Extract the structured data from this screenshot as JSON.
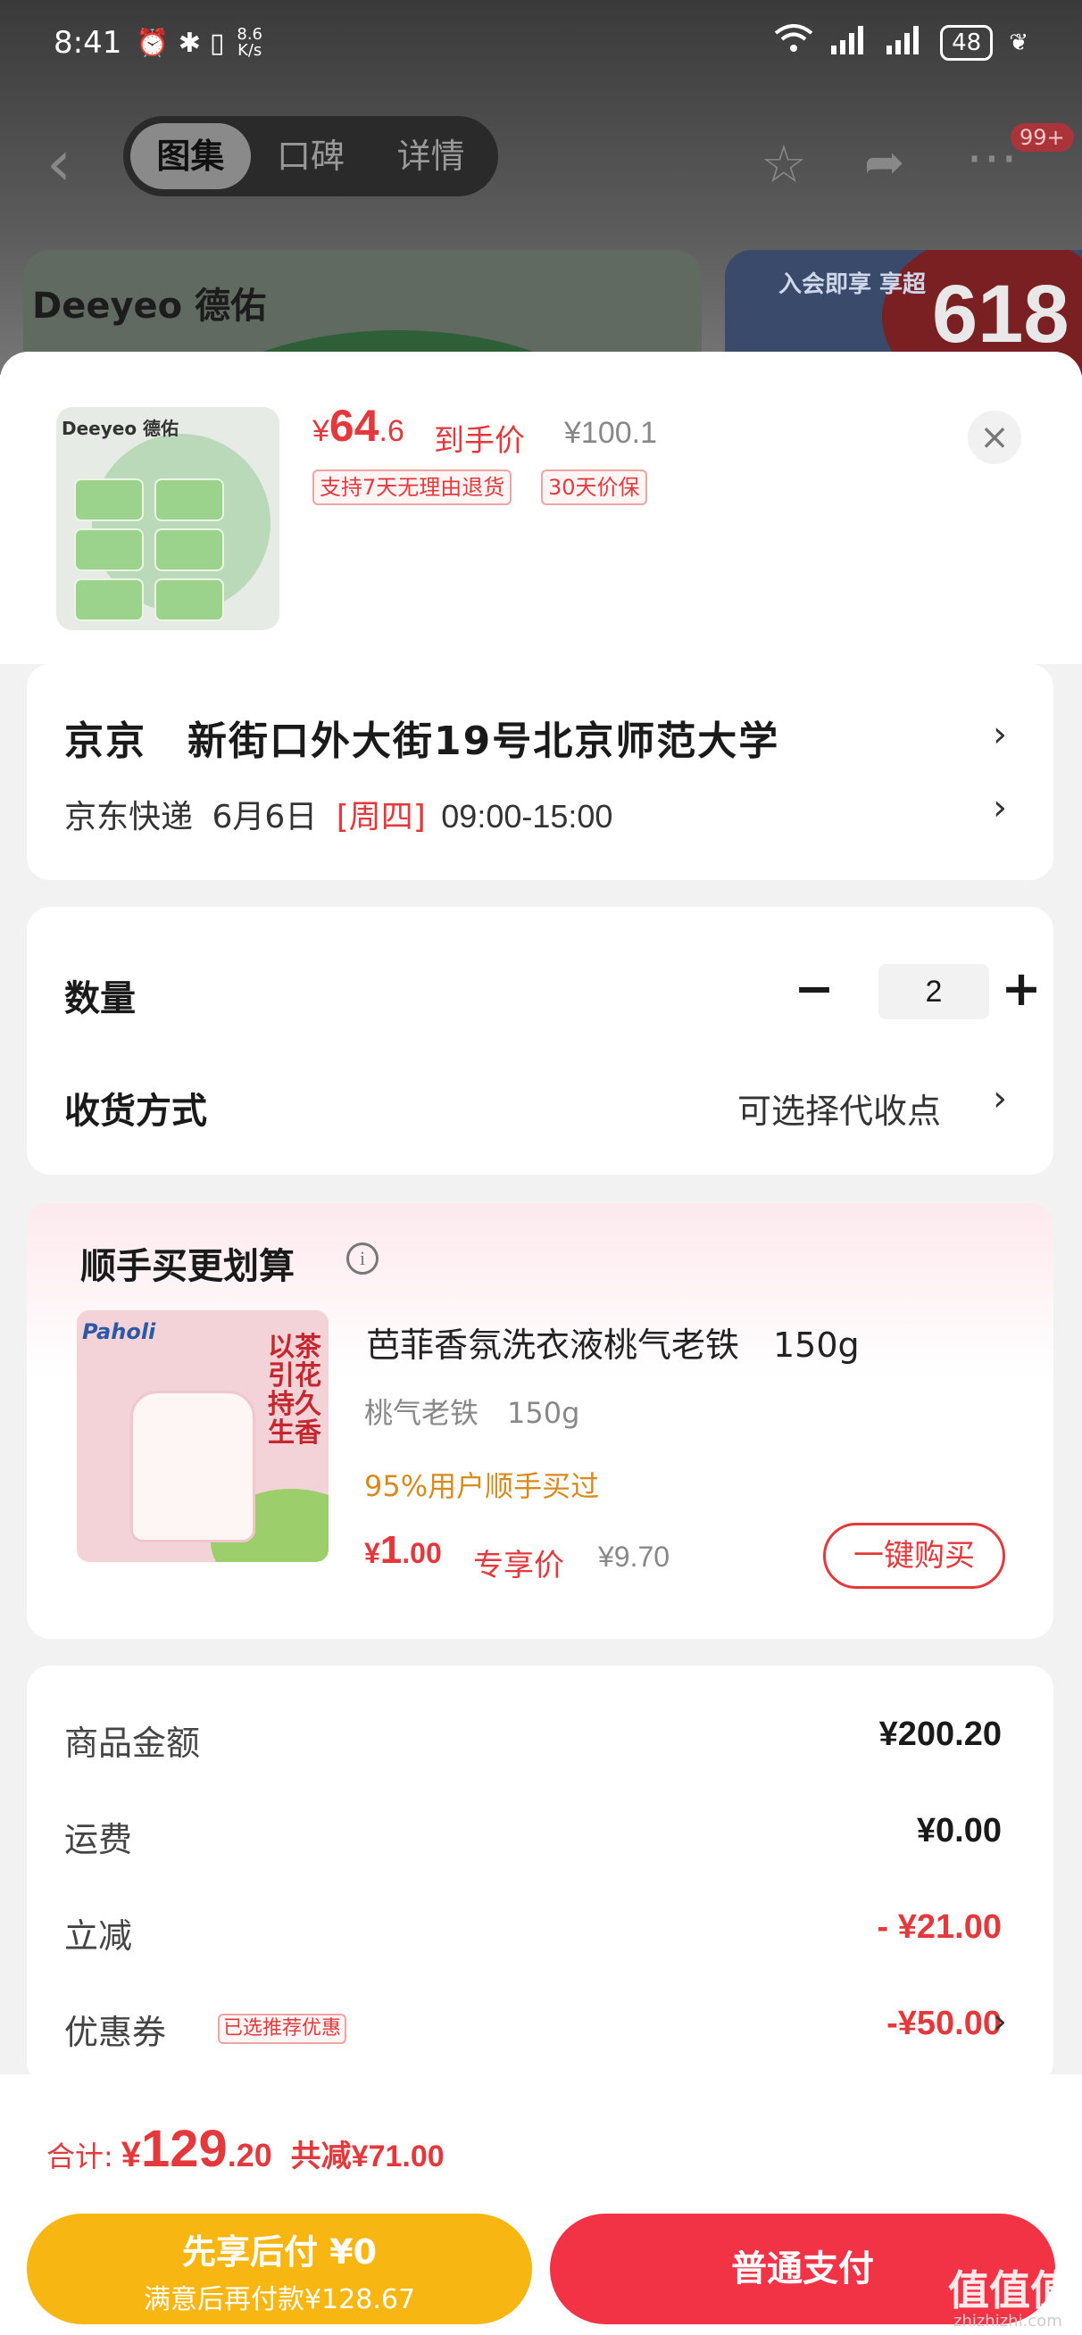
{
  "status_bar": {
    "time": "8:41",
    "net_speed_value": "8.6",
    "net_speed_unit": "K/s",
    "battery": "48"
  },
  "nav": {
    "tabs": [
      "图集",
      "口碑",
      "详情"
    ],
    "badge": "99+"
  },
  "banners": {
    "brand_logo": "Deeyeo 德佑",
    "member_text": "入会即享 享超",
    "promo_number": "618"
  },
  "product": {
    "thumb_brand": "Deeyeo 德佑",
    "price_currency": "¥",
    "price_int": "64",
    "price_dec": ".6",
    "price_label": "到手价",
    "original_price": "¥100.1",
    "tags": [
      "支持7天无理由退货",
      "30天价保"
    ]
  },
  "address": {
    "line1": "京京　新街口外大街19号北京师范大学",
    "carrier": "京东快递",
    "date": "6月6日",
    "weekday": "[周四]",
    "time_slot": "09:00-15:00"
  },
  "quantity": {
    "label": "数量",
    "value": "2",
    "minus": "−",
    "plus": "+"
  },
  "delivery_method": {
    "label": "收货方式",
    "value": "可选择代收点"
  },
  "upsell": {
    "heading": "顺手买更划算",
    "info_icon": "i",
    "image_brand": "Paholi",
    "image_poem": "以茶引花 持久生香",
    "title": "芭菲香氛洗衣液桃气老铁　150g",
    "spec": "桃气老铁　150g",
    "bought": "95%用户顺手买过",
    "price_currency": "¥",
    "price_int": "1",
    "price_dec": ".00",
    "price_label": "专享价",
    "original_price": "¥9.70",
    "button": "一键购买"
  },
  "summary": {
    "rows": [
      {
        "label": "商品金额",
        "value": "¥200.20"
      },
      {
        "label": "运费",
        "value": "¥0.00"
      },
      {
        "label": "立减",
        "value": "- ¥21.00"
      },
      {
        "label": "优惠券",
        "value": "-¥50.00",
        "pill": "已选推荐优惠"
      }
    ]
  },
  "footer": {
    "total_label": "合计:",
    "total_currency": "¥",
    "total_int": "129",
    "total_dec": ".20",
    "total_saved": "共减¥71.00",
    "pay_later_title": "先享后付 ¥0",
    "pay_later_sub": "满意后再付款¥128.67",
    "pay_normal": "普通支付"
  },
  "watermark": {
    "text": "值值值",
    "site": "zhizhizhi.com"
  },
  "colors": {
    "accent_red": "#e4393c",
    "pay_red": "#f23346",
    "pay_yellow": "#f8b613"
  }
}
